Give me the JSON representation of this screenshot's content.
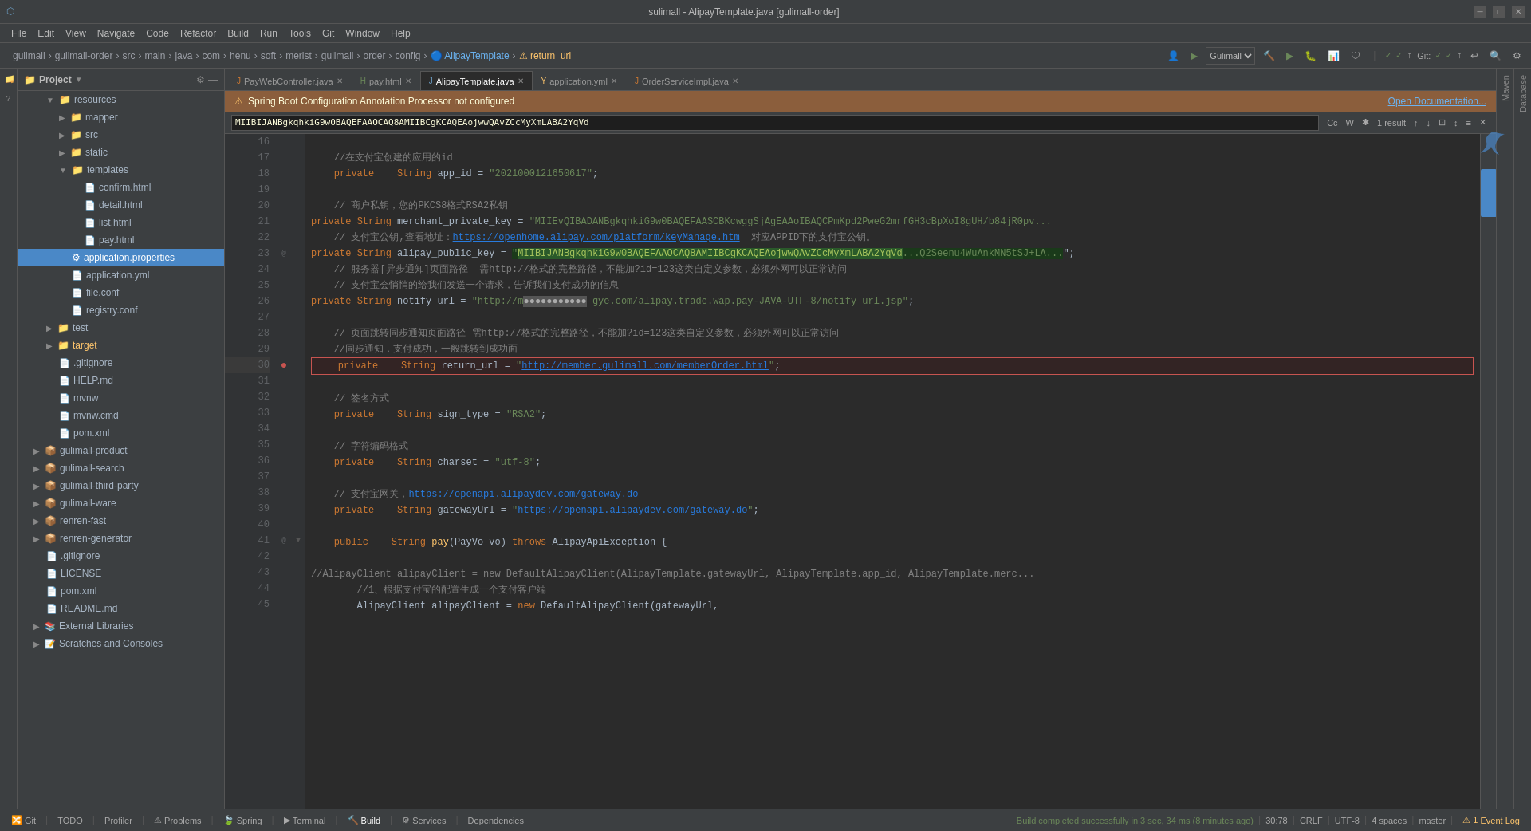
{
  "titleBar": {
    "title": "sulimall - AlipayTemplate.java [gulimall-order]",
    "minBtn": "─",
    "maxBtn": "□",
    "closeBtn": "✕"
  },
  "breadcrumb": {
    "items": [
      "gulimall",
      "gulimall-order",
      "src",
      "main",
      "java",
      "com",
      "henu",
      "soft",
      "merist",
      "gulimall",
      "order",
      "config",
      "AlipayTemplate",
      "return_url"
    ]
  },
  "tabs": [
    {
      "label": "PayWebController.java",
      "type": "java",
      "active": false,
      "modified": false
    },
    {
      "label": "pay.html",
      "type": "html",
      "active": false,
      "modified": false
    },
    {
      "label": "AlipayTemplate.java",
      "type": "java",
      "active": true,
      "modified": false
    },
    {
      "label": "application.yml",
      "type": "yml",
      "active": false,
      "modified": false
    },
    {
      "label": "OrderServiceImpl.java",
      "type": "java",
      "active": false,
      "modified": false
    }
  ],
  "warningBar": {
    "text": "Spring Boot Configuration Annotation Processor not configured",
    "linkText": "Open Documentation..."
  },
  "searchBar": {
    "query": "MIIBIJANBgkqhkiG9w0BAQEFAAOCAQ8AMIIBCgKCAQEAojwwQAvZCcMyXmLABA2YqVd",
    "resultText": "1 result"
  },
  "projectPanel": {
    "title": "Project",
    "items": [
      {
        "label": "resources",
        "indent": 2,
        "type": "folder",
        "expanded": true
      },
      {
        "label": "mapper",
        "indent": 3,
        "type": "folder",
        "expanded": false
      },
      {
        "label": "src",
        "indent": 3,
        "type": "folder",
        "expanded": false
      },
      {
        "label": "static",
        "indent": 3,
        "type": "folder",
        "expanded": false
      },
      {
        "label": "templates",
        "indent": 3,
        "type": "folder",
        "expanded": true
      },
      {
        "label": "confirm.html",
        "indent": 4,
        "type": "html"
      },
      {
        "label": "detail.html",
        "indent": 4,
        "type": "html"
      },
      {
        "label": "list.html",
        "indent": 4,
        "type": "html"
      },
      {
        "label": "pay.html",
        "indent": 4,
        "type": "html"
      },
      {
        "label": "application.properties",
        "indent": 3,
        "type": "properties",
        "selected": true
      },
      {
        "label": "application.yml",
        "indent": 3,
        "type": "yml"
      },
      {
        "label": "file.conf",
        "indent": 3,
        "type": "conf"
      },
      {
        "label": "registry.conf",
        "indent": 3,
        "type": "conf"
      },
      {
        "label": "test",
        "indent": 2,
        "type": "folder",
        "expanded": false
      },
      {
        "label": "target",
        "indent": 2,
        "type": "folder",
        "expanded": false,
        "special": true
      },
      {
        "label": ".gitignore",
        "indent": 2,
        "type": "git"
      },
      {
        "label": "HELP.md",
        "indent": 2,
        "type": "md"
      },
      {
        "label": "mvnw",
        "indent": 2,
        "type": "file"
      },
      {
        "label": "mvnw.cmd",
        "indent": 2,
        "type": "file"
      },
      {
        "label": "pom.xml",
        "indent": 2,
        "type": "xml"
      },
      {
        "label": "gulimall-product",
        "indent": 1,
        "type": "module",
        "expanded": false
      },
      {
        "label": "gulimall-search",
        "indent": 1,
        "type": "module",
        "expanded": false
      },
      {
        "label": "gulimall-third-party",
        "indent": 1,
        "type": "module",
        "expanded": false
      },
      {
        "label": "gulimall-ware",
        "indent": 1,
        "type": "module",
        "expanded": false
      },
      {
        "label": "renren-fast",
        "indent": 1,
        "type": "module",
        "expanded": false
      },
      {
        "label": "renren-generator",
        "indent": 1,
        "type": "module",
        "expanded": false
      },
      {
        "label": ".gitignore",
        "indent": 1,
        "type": "git"
      },
      {
        "label": "LICENSE",
        "indent": 1,
        "type": "file"
      },
      {
        "label": "pom.xml",
        "indent": 1,
        "type": "xml"
      },
      {
        "label": "README.md",
        "indent": 1,
        "type": "md"
      },
      {
        "label": "External Libraries",
        "indent": 1,
        "type": "folder",
        "expanded": false
      },
      {
        "label": "Scratches and Consoles",
        "indent": 1,
        "type": "folder",
        "expanded": false
      }
    ]
  },
  "codeLines": [
    {
      "num": 16,
      "content": ""
    },
    {
      "num": 17,
      "content": "    //在支付宝创建的应用的id"
    },
    {
      "num": 18,
      "content": "    private    String app_id = \"2021000121650617\";"
    },
    {
      "num": 19,
      "content": ""
    },
    {
      "num": 20,
      "content": "    // 商户私钥，您的PKCS8格式RSA2私钥"
    },
    {
      "num": 21,
      "content": "    private    String merchant_private_key = \"MIIEvQIBADANBgkqhkiG9w0BAQEFAASCBKcwggSjAgEAAoIBAQCPmKpd2PweG2mrfGH3cBpXoI8gUH/b84jR0p..."
    },
    {
      "num": 22,
      "content": "    // 支付宝公钥,查看地址：https://openhome.alipay.com/platform/keyManage.htm  对应APPID下的支付宝公钥。"
    },
    {
      "num": 23,
      "content": "    private    String alipay_public_key = \"MIIBIJANBgkqhkiG9w0BAQEFAAOCAQ8AMIIBCgKCAQEAojwwQAvZCcMyXmLABA2YqVd...Q2Seenu4WuAnkMN5tSJ+LA..."
    },
    {
      "num": 24,
      "content": "    // 服务器[异步通知]页面路径  需http://格式的完整路径，不能加?id=123这类自定义参数，必须外网可以正常访问"
    },
    {
      "num": 25,
      "content": "    // 支付宝会悄悄的给我们发送一个请求，告诉我们支付成功的信息"
    },
    {
      "num": 26,
      "content": "    private    String notify_url = \"http://m●●●●●●●●●●●_gye.com/alipay.trade.wap.pay-JAVA-UTF-8/notify_url.jsp\";"
    },
    {
      "num": 27,
      "content": ""
    },
    {
      "num": 28,
      "content": "    // 页面跳转同步通知页面路径 需http://格式的完整路径，不能加?id=123这类自定义参数，必须外网可以正常访问"
    },
    {
      "num": 29,
      "content": "    //同步通知，支付成功，一般跳转到成功面"
    },
    {
      "num": 30,
      "content": "    private    String return_url = \"http://member.gulimall.com/memberOrder.html\";",
      "highlight": true
    },
    {
      "num": 31,
      "content": ""
    },
    {
      "num": 32,
      "content": "    // 签名方式"
    },
    {
      "num": 33,
      "content": "    private    String sign_type = \"RSA2\";"
    },
    {
      "num": 34,
      "content": ""
    },
    {
      "num": 35,
      "content": "    // 字符编码格式"
    },
    {
      "num": 36,
      "content": "    private    String charset = \"utf-8\";"
    },
    {
      "num": 37,
      "content": ""
    },
    {
      "num": 38,
      "content": "    // 支付宝网关，https://openapi.alipaydev.com/gateway.do"
    },
    {
      "num": 39,
      "content": "    private    String gatewayUrl = \"https://openapi.alipaydev.com/gateway.do\";"
    },
    {
      "num": 40,
      "content": ""
    },
    {
      "num": 41,
      "content": "    public    String pay(PayVo vo) throws AlipayApiException {"
    },
    {
      "num": 42,
      "content": ""
    },
    {
      "num": 43,
      "content": "        //AlipayClient alipayClient = new DefaultAlipayClient(AlipayTemplate.gatewayUrl, AlipayTemplate.app_id, AlipayTemplate.merc..."
    },
    {
      "num": 44,
      "content": "        //1、根据支付宝的配置生成一个支付客户端"
    },
    {
      "num": 45,
      "content": "        AlipayClient alipayClient = new DefaultAlipayClient(gatewayUrl,"
    }
  ],
  "statusBar": {
    "git": "Git",
    "todo": "TODO",
    "profiler": "Profiler",
    "problems": "Problems",
    "spring": "Spring",
    "terminal": "Terminal",
    "build": "Build",
    "services": "Services",
    "dependencies": "Dependencies",
    "buildStatus": "Build completed successfully in 3 sec, 34 ms (8 minutes ago)",
    "lineCol": "30:78",
    "crlf": "CRLF",
    "encoding": "UTF-8",
    "indent": "4 spaces",
    "branch": "master"
  },
  "rightPanelLabels": {
    "maven": "Maven",
    "database": "Database"
  }
}
